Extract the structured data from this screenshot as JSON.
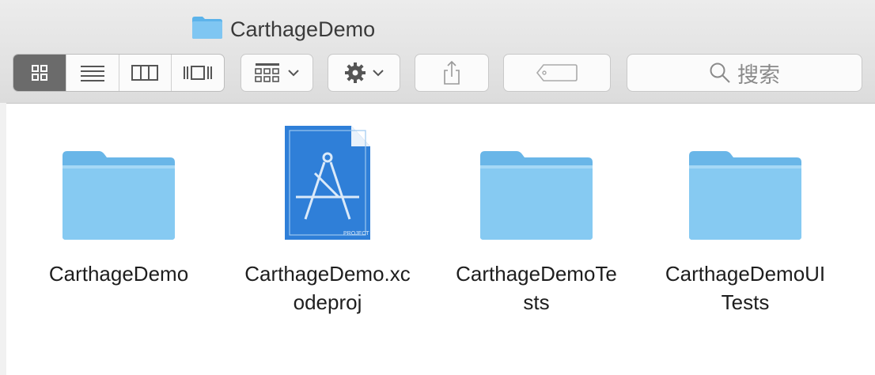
{
  "window": {
    "title": "CarthageDemo"
  },
  "toolbar": {
    "view_modes": [
      "icon-view",
      "list-view",
      "column-view",
      "cover-flow-view"
    ],
    "active_view": "icon-view",
    "search_placeholder": "搜索"
  },
  "files": [
    {
      "name": "CarthageDemo",
      "line1": "CarthageDemo",
      "line2": "",
      "kind": "folder"
    },
    {
      "name": "CarthageDemo.xcodeproj",
      "line1": "CarthageDemo.xc",
      "line2": "odeproj",
      "kind": "xcodeproj",
      "badge": "PROJECT"
    },
    {
      "name": "CarthageDemoTests",
      "line1": "CarthageDemoTe",
      "line2": "sts",
      "kind": "folder"
    },
    {
      "name": "CarthageDemoUITests",
      "line1": "CarthageDemoUI",
      "line2": "Tests",
      "kind": "folder"
    }
  ],
  "colors": {
    "folder": "#7ec3ee",
    "xcode": "#2f7fd8",
    "active_segment": "#6b6b6b"
  }
}
